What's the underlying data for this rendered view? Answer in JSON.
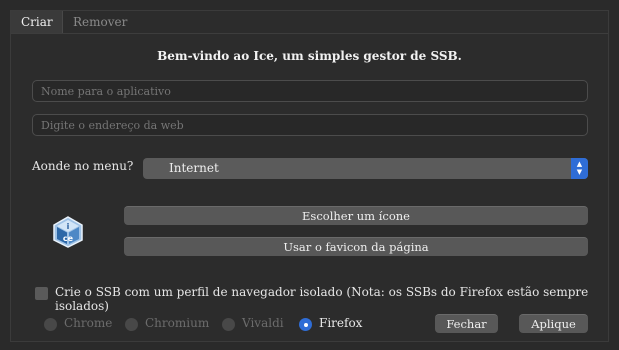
{
  "tabs": [
    {
      "label": "Criar"
    },
    {
      "label": "Remover"
    }
  ],
  "welcome": "Bem-vindo ao Ice, um simples gestor de SSB.",
  "app_name_input": {
    "placeholder": "Nome para o aplicativo",
    "value": ""
  },
  "url_input": {
    "placeholder": "Digite o endereço da web",
    "value": ""
  },
  "menu": {
    "label": "Aonde no menu?",
    "selected": "Internet"
  },
  "icon_section": {
    "logo_icon": "ice-logo-icon",
    "choose_icon_label": "Escolher um ícone",
    "favicon_label": "Usar o favicon da página"
  },
  "isolated_profile": {
    "label": "Crie o SSB com um perfil de navegador isolado (Nota: os SSBs do Firefox estão sempre isolados)",
    "checked": false
  },
  "browsers": [
    {
      "label": "Chrome",
      "selected": false,
      "enabled": false
    },
    {
      "label": "Chromium",
      "selected": false,
      "enabled": false
    },
    {
      "label": "Vivaldi",
      "selected": false,
      "enabled": false
    },
    {
      "label": "Firefox",
      "selected": true,
      "enabled": true
    }
  ],
  "actions": {
    "close_label": "Fechar",
    "apply_label": "Aplique"
  },
  "colors": {
    "background": "#2c2c2c",
    "accent": "#2f6dd6",
    "button": "#585858"
  }
}
